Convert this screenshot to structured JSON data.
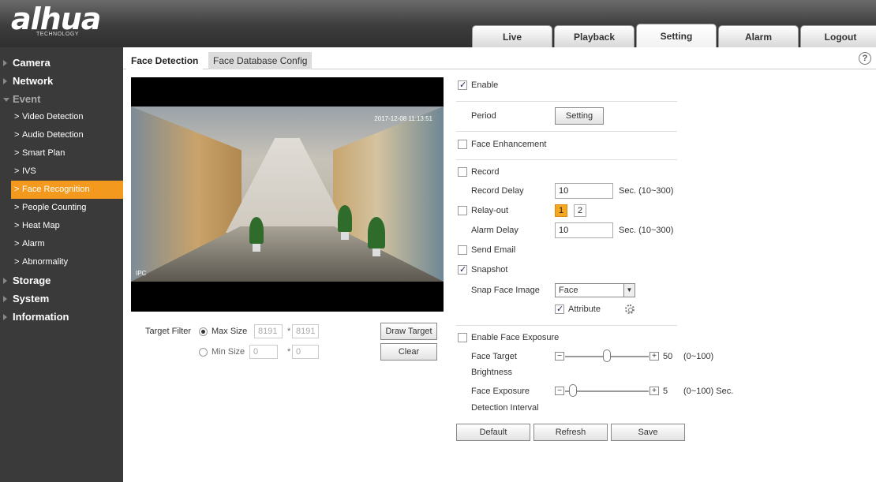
{
  "brand": {
    "logo": "alhua",
    "sub": "TECHNOLOGY"
  },
  "nav": [
    "Live",
    "Playback",
    "Setting",
    "Alarm",
    "Logout"
  ],
  "sidebar": {
    "items": [
      {
        "label": "Camera",
        "type": "main"
      },
      {
        "label": "Network",
        "type": "main"
      },
      {
        "label": "Event",
        "type": "main-open"
      },
      {
        "label": "Video Detection",
        "type": "sub"
      },
      {
        "label": "Audio Detection",
        "type": "sub"
      },
      {
        "label": "Smart Plan",
        "type": "sub"
      },
      {
        "label": "IVS",
        "type": "sub"
      },
      {
        "label": "Face Recognition",
        "type": "sub-active"
      },
      {
        "label": "People Counting",
        "type": "sub"
      },
      {
        "label": "Heat Map",
        "type": "sub"
      },
      {
        "label": "Alarm",
        "type": "sub"
      },
      {
        "label": "Abnormality",
        "type": "sub"
      },
      {
        "label": "Storage",
        "type": "main"
      },
      {
        "label": "System",
        "type": "main"
      },
      {
        "label": "Information",
        "type": "main"
      }
    ]
  },
  "tabs": {
    "active": "Face Detection",
    "inactive": "Face Database Config"
  },
  "help": "?",
  "video": {
    "timestamp": "2017-12-08 11:13:51",
    "channel": "IPC"
  },
  "target_filter": {
    "label": "Target Filter",
    "max_label": "Max Size",
    "max_w": "8191",
    "max_h": "8191",
    "min_label": "Min Size",
    "min_w": "0",
    "min_h": "0",
    "times": "*",
    "draw_btn": "Draw Target",
    "clear_btn": "Clear"
  },
  "settings": {
    "enable": "Enable",
    "period": "Period",
    "period_btn": "Setting",
    "face_enhancement": "Face Enhancement",
    "record": "Record",
    "record_delay": "Record Delay",
    "record_delay_val": "10",
    "record_delay_unit": "Sec. (10~300)",
    "relay_out": "Relay-out",
    "relay_1": "1",
    "relay_2": "2",
    "alarm_delay": "Alarm Delay",
    "alarm_delay_val": "10",
    "alarm_delay_unit": "Sec. (10~300)",
    "send_email": "Send Email",
    "snapshot": "Snapshot",
    "snap_face": "Snap Face Image",
    "snap_face_val": "Face",
    "attribute": "Attribute",
    "enable_exposure": "Enable Face Exposure",
    "brightness_l1": "Face Target",
    "brightness_l2": "Brightness",
    "brightness_val": "50",
    "brightness_range": "(0~100)",
    "brightness_level": 0.5,
    "interval_l1": "Face Exposure",
    "interval_l2": "Detection Interval",
    "interval_val": "5",
    "interval_range": "(0~100) Sec.",
    "interval_level": 0.05,
    "minus": "−",
    "plus": "+"
  },
  "footer": {
    "default": "Default",
    "refresh": "Refresh",
    "save": "Save"
  },
  "colors": {
    "accent": "#f39a1e",
    "sidebar_bg": "#3a3a3a"
  }
}
